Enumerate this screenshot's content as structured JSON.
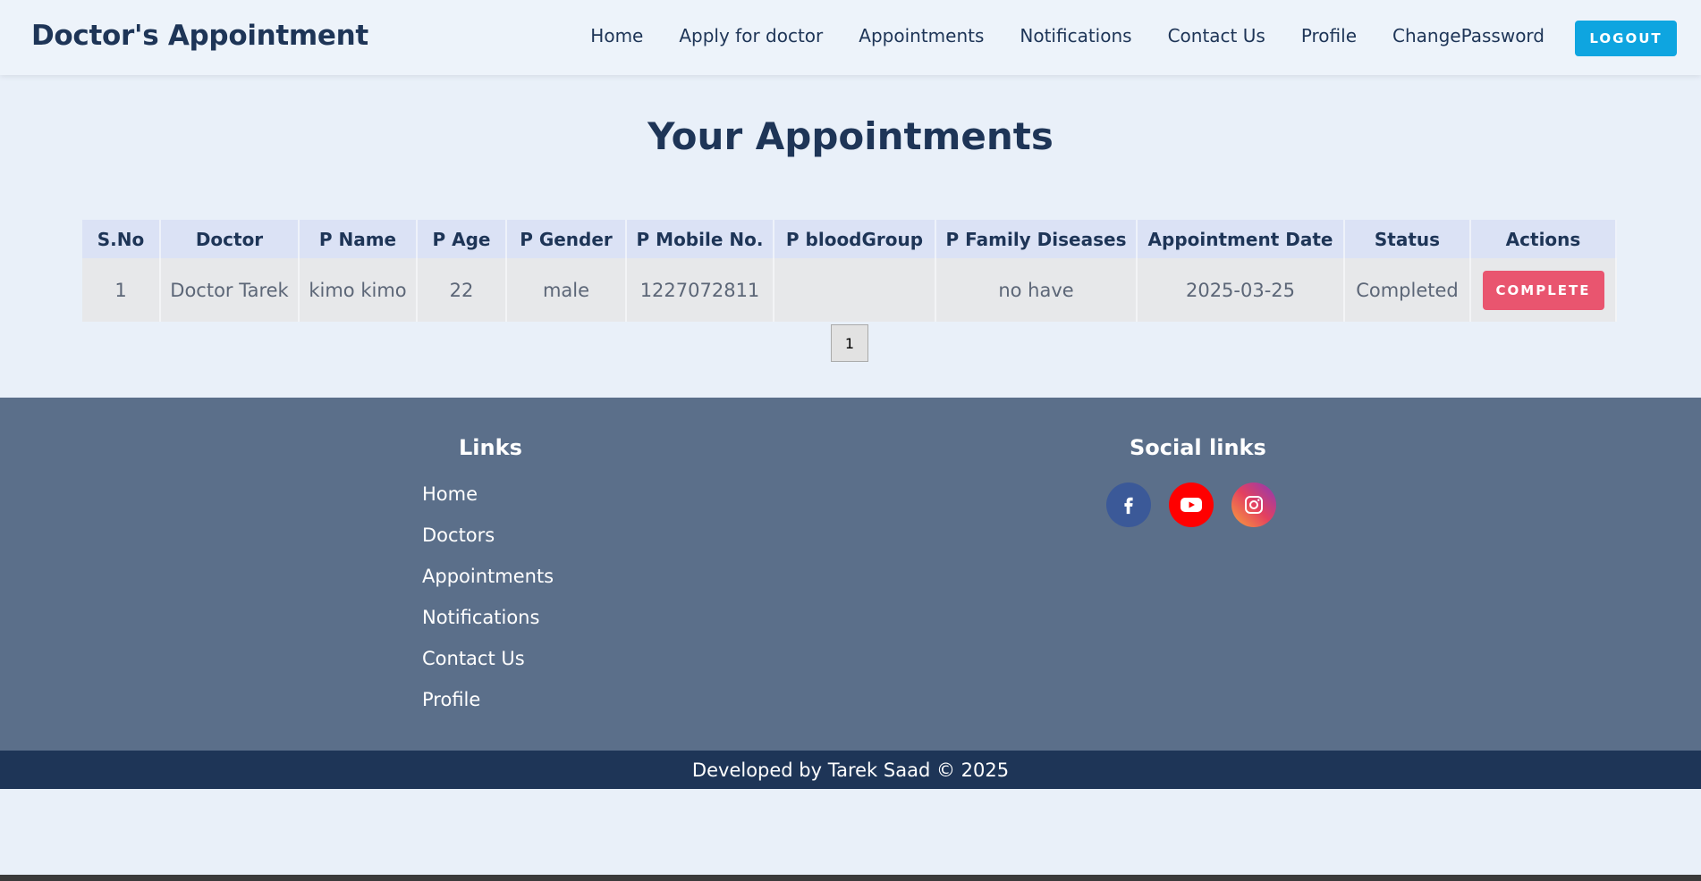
{
  "header": {
    "brand": "Doctor's Appointment",
    "nav": [
      {
        "label": "Home"
      },
      {
        "label": "Apply for doctor"
      },
      {
        "label": "Appointments"
      },
      {
        "label": "Notifications"
      },
      {
        "label": "Contact Us"
      },
      {
        "label": "Profile"
      },
      {
        "label": "ChangePassword"
      }
    ],
    "logout_label": "LOGOUT"
  },
  "main": {
    "title": "Your Appointments",
    "table": {
      "columns": [
        "S.No",
        "Doctor",
        "P Name",
        "P Age",
        "P Gender",
        "P Mobile No.",
        "P bloodGroup",
        "P Family Diseases",
        "Appointment Date",
        "Status",
        "Actions"
      ],
      "rows": [
        {
          "sno": "1",
          "doctor": "Doctor Tarek",
          "p_name": "kimo kimo",
          "p_age": "22",
          "p_gender": "male",
          "p_mobile": "1227072811",
          "p_blood_group": "",
          "p_family_diseases": "no have",
          "appointment_date": "2025-03-25",
          "status": "Completed",
          "action_label": "COMPLETE"
        }
      ]
    },
    "pagination": {
      "current_page": "1"
    }
  },
  "footer": {
    "links_heading": "Links",
    "links": [
      {
        "label": "Home"
      },
      {
        "label": "Doctors"
      },
      {
        "label": "Appointments"
      },
      {
        "label": "Notifications"
      },
      {
        "label": "Contact Us"
      },
      {
        "label": "Profile"
      }
    ],
    "social_heading": "Social links",
    "social": [
      {
        "icon": "facebook-icon",
        "color": "#3b5998"
      },
      {
        "icon": "youtube-icon",
        "color": "#ff0000"
      },
      {
        "icon": "instagram-icon",
        "color": "#e4405f"
      }
    ],
    "copyright": "Developed by Tarek Saad © 2025"
  },
  "colors": {
    "primary_dark": "#1e3557",
    "accent": "#0ea5e0",
    "danger": "#e9556f",
    "footer_bg": "#5b6f8a",
    "page_bg": "#e9f0f9"
  }
}
